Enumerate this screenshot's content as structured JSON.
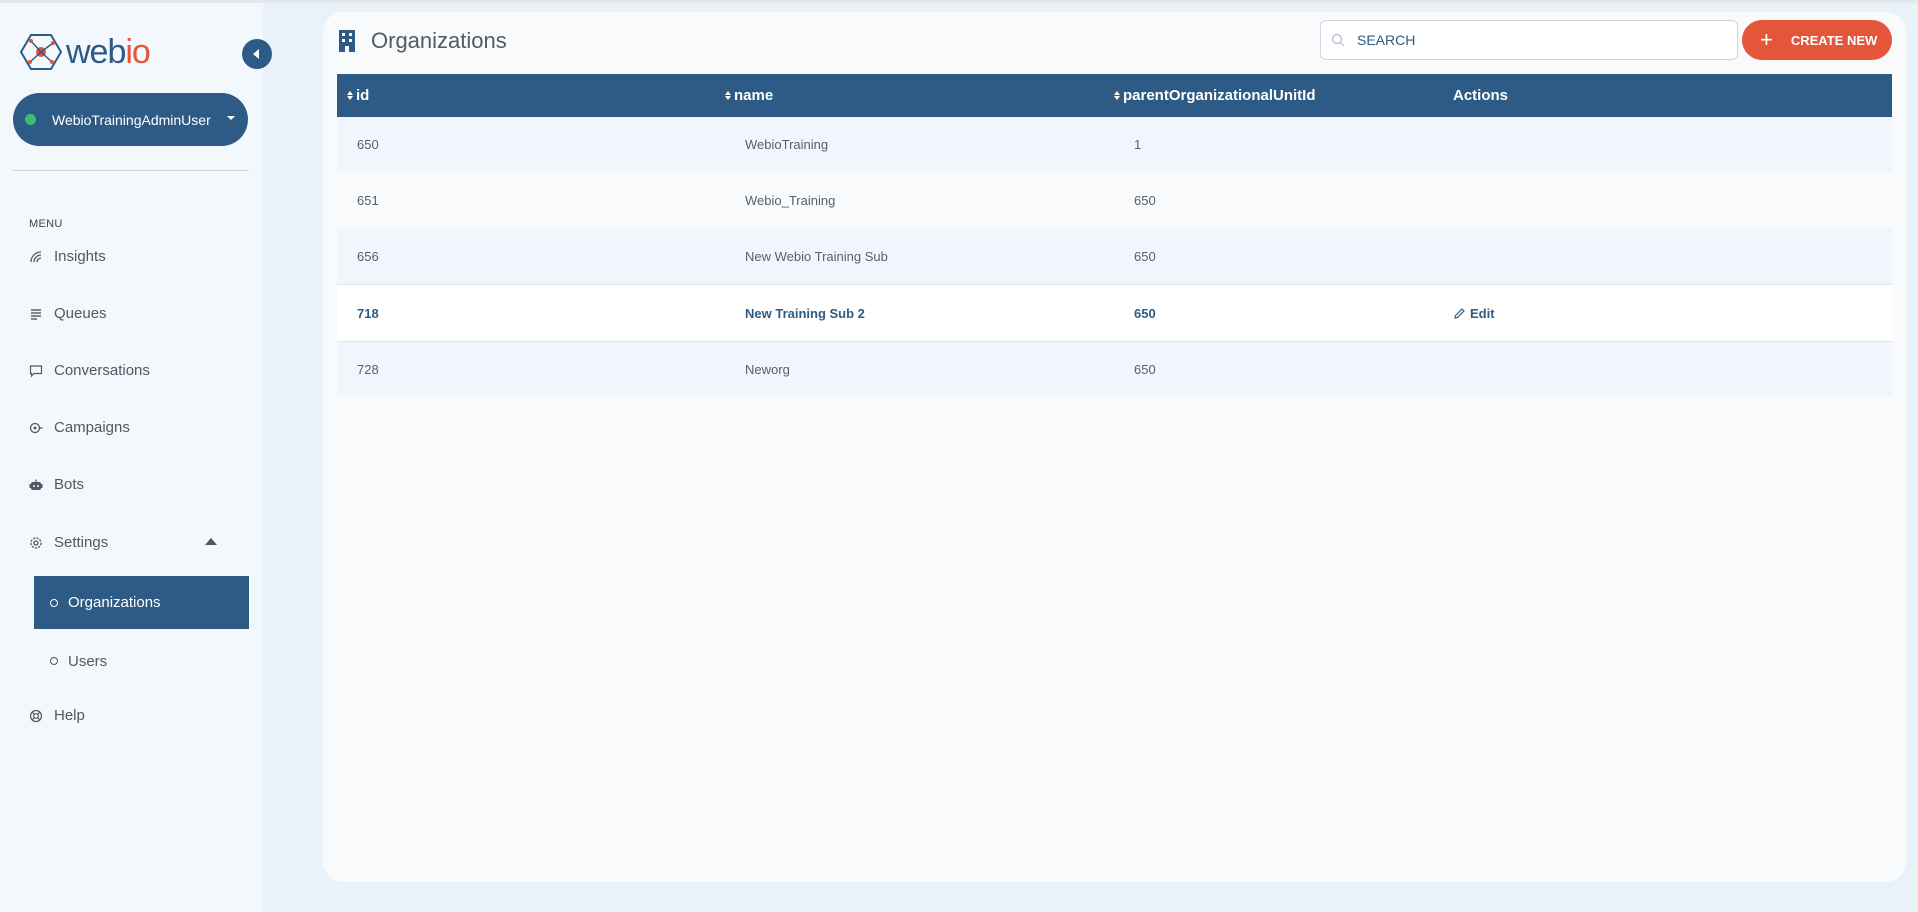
{
  "app": {
    "logo_web": "web",
    "logo_io": "io"
  },
  "user": {
    "name": "WebioTrainingAdminUser",
    "status_color": "#38c172"
  },
  "sidebar": {
    "menu_label": "MENU",
    "items": [
      {
        "label": "Insights",
        "icon": "insights-icon"
      },
      {
        "label": "Queues",
        "icon": "queues-icon"
      },
      {
        "label": "Conversations",
        "icon": "conversations-icon"
      },
      {
        "label": "Campaigns",
        "icon": "campaigns-icon"
      },
      {
        "label": "Bots",
        "icon": "bots-icon"
      },
      {
        "label": "Settings",
        "icon": "gear-icon"
      }
    ],
    "settings_sub": [
      {
        "label": "Organizations",
        "active": true
      },
      {
        "label": "Users",
        "active": false
      }
    ],
    "help_label": "Help"
  },
  "page": {
    "title": "Organizations",
    "search_placeholder": "SEARCH",
    "create_label": "CREATE NEW"
  },
  "table": {
    "columns": [
      "id",
      "name",
      "parentOrganizationalUnitId",
      "Actions"
    ],
    "rows": [
      {
        "id": "650",
        "name": "WebioTraining",
        "parent": "1"
      },
      {
        "id": "651",
        "name": "Webio_Training",
        "parent": "650"
      },
      {
        "id": "656",
        "name": "New Webio Training Sub",
        "parent": "650"
      },
      {
        "id": "718",
        "name": "New Training Sub 2",
        "parent": "650",
        "action": "Edit"
      },
      {
        "id": "728",
        "name": "Neworg",
        "parent": "650"
      }
    ]
  },
  "colors": {
    "primary": "#2e5b86",
    "accent": "#e4553a"
  }
}
